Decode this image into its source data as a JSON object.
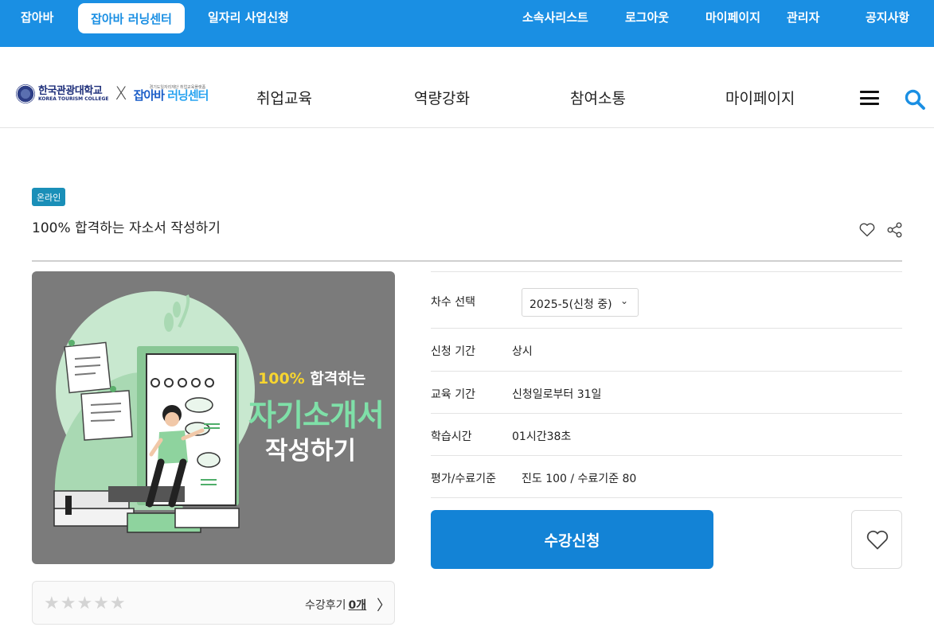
{
  "topbar": {
    "left_items": [
      "잡아바",
      "잡아바 러닝센터",
      "일자리 사업신청"
    ],
    "right_items": [
      "소속사리스트",
      "로그아웃",
      "마이페이지",
      "관리자",
      "공지사항"
    ]
  },
  "header": {
    "logo": {
      "univ_ko": "한국관광대학교",
      "univ_en": "KOREA TOURISM COLLEGE",
      "separator": "X",
      "tiny": "경기도일자리재단 취업교육플랫폼",
      "brand_a": "잡아바",
      "brand_b": "러닝센터"
    },
    "nav": [
      "취업교육",
      "역량강화",
      "참여소통",
      "마이페이지"
    ]
  },
  "course": {
    "badge": "온라인",
    "title": "100% 합격하는 자소서 작성하기",
    "thumb": {
      "line1_yellow": "100%",
      "line1_rest": " 합격하는",
      "line2": "자기소개서",
      "line3": "작성하기"
    },
    "reviews": {
      "label": "수강후기",
      "count": "0개",
      "stars": "★★★★★"
    },
    "info": {
      "session_label": "차수 선택",
      "session_value": "2025-5(신청 중)",
      "apply_period_label": "신청 기간",
      "apply_period_value": "상시",
      "edu_period_label": "교육 기간",
      "edu_period_value": "신청일로부터 31일",
      "study_time_label": "학습시간",
      "study_time_value": "01시간38초",
      "criteria_label": "평가/수료기준",
      "criteria_value": "진도 100 / 수료기준 80"
    },
    "apply_button": "수강신청"
  },
  "colors": {
    "primary": "#1a8fe3",
    "apply": "#1383d6",
    "badge": "#1a8fb8",
    "thumb_bg": "#7b7b7b",
    "thumb_green": "#7fe0a8"
  }
}
